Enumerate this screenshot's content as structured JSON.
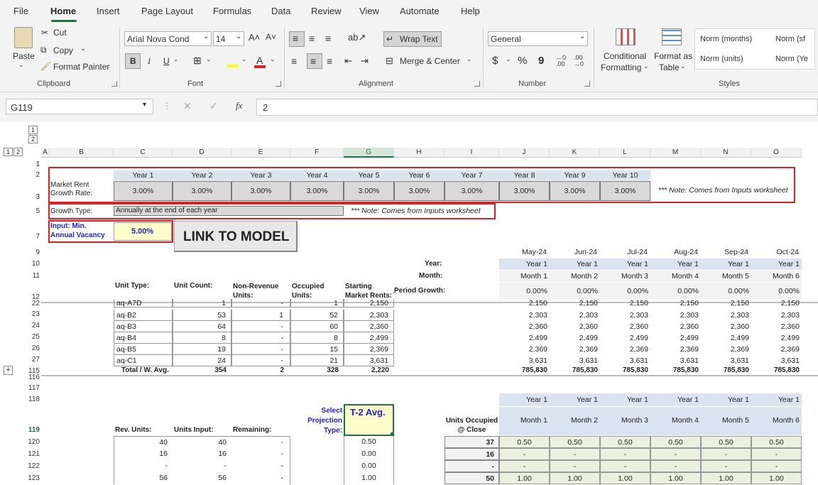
{
  "menu": {
    "items": [
      "File",
      "Home",
      "Insert",
      "Page Layout",
      "Formulas",
      "Data",
      "Review",
      "View",
      "Automate",
      "Help"
    ]
  },
  "ribbon": {
    "clipboard": {
      "paste": "Paste",
      "cut": "Cut",
      "copy": "Copy",
      "format_painter": "Format Painter",
      "label": "Clipboard"
    },
    "font": {
      "name": "Arial Nova Cond",
      "size": "14",
      "bold": "B",
      "italic": "I",
      "underline": "U",
      "label": "Font"
    },
    "alignment": {
      "wrap_text": "Wrap Text",
      "merge_center": "Merge & Center",
      "label": "Alignment"
    },
    "number": {
      "format": "General",
      "currency": "$",
      "percent": "%",
      "comma": "9",
      "label": "Number"
    },
    "styles": {
      "conditional": "Conditional",
      "formatting": "Formatting",
      "format_as": "Format as",
      "table": "Table",
      "style1": "Norm (months)",
      "style2": "Norm (sf",
      "style3": "Norm (units)",
      "style4": "Norm (Ye",
      "label": "Styles"
    }
  },
  "formula_bar": {
    "name_box": "G119",
    "fx": "fx",
    "value": "2"
  },
  "columns": [
    "A",
    "B",
    "C",
    "D",
    "E",
    "F",
    "G",
    "H",
    "I",
    "J",
    "K",
    "L",
    "M",
    "N",
    "O"
  ],
  "outline_levels": [
    "1",
    "2"
  ],
  "rows": {
    "r1": "1",
    "r2": "2",
    "r3": "3",
    "r5": "5",
    "r7": "7",
    "r9": "9",
    "r10": "10",
    "r11": "11",
    "r12": "12",
    "r22": "22",
    "r23": "23",
    "r24": "24",
    "r25": "25",
    "r26": "26",
    "r27": "27",
    "r115": "115",
    "r116": "116",
    "r117": "117",
    "r118": "118",
    "r119": "119",
    "r120": "120",
    "r121": "121",
    "r122": "122",
    "r123": "123"
  },
  "growth": {
    "label1": "Market Rent",
    "label2": "Growth Rate:",
    "years": [
      "Year 1",
      "Year 2",
      "Year 3",
      "Year 4",
      "Year 5",
      "Year 6",
      "Year 7",
      "Year 8",
      "Year 9",
      "Year 10"
    ],
    "rates": [
      "3.00%",
      "3.00%",
      "3.00%",
      "3.00%",
      "3.00%",
      "3.00%",
      "3.00%",
      "3.00%",
      "3.00%",
      "3.00%"
    ],
    "note": "*** Note: Comes from Inputs worksheet"
  },
  "growth_type": {
    "label": "Growth Type:",
    "value": "Annually at the end of each year",
    "note": "*** Note: Comes from Inputs worksheet"
  },
  "vacancy": {
    "label1": "Input: Min.",
    "label2": "Annual Vacancy",
    "value": "5.00%"
  },
  "link_button": "LINK TO MODEL",
  "timeline": {
    "months": [
      "May-24",
      "Jun-24",
      "Jul-24",
      "Aug-24",
      "Sep-24",
      "Oct-24"
    ],
    "year_label": "Year:",
    "month_label": "Month:",
    "period_label": "Period Growth:",
    "years": [
      "Year 1",
      "Year 1",
      "Year 1",
      "Year 1",
      "Year 1",
      "Year 1"
    ],
    "month_nums": [
      "Month 1",
      "Month 2",
      "Month 3",
      "Month 4",
      "Month 5",
      "Month 6"
    ],
    "growth": [
      "0.00%",
      "0.00%",
      "0.00%",
      "0.00%",
      "0.00%",
      "0.00%"
    ]
  },
  "unit_table": {
    "headers": {
      "unit_type": "Unit Type:",
      "unit_count": "Unit Count:",
      "nonrev1": "Non-Revenue",
      "nonrev2": "Units:",
      "occ1": "Occupied",
      "occ2": "Units:",
      "start1": "Starting",
      "start2": "Market Rents:"
    },
    "rows": [
      {
        "type": "aq-A7D",
        "count": "1",
        "nonrev": "-",
        "occ": "1",
        "rent": "2,150",
        "vals": [
          "2,150",
          "2,150",
          "2,150",
          "2,150",
          "2,150",
          "2,150"
        ]
      },
      {
        "type": "aq-B2",
        "count": "53",
        "nonrev": "1",
        "occ": "52",
        "rent": "2,303",
        "vals": [
          "2,303",
          "2,303",
          "2,303",
          "2,303",
          "2,303",
          "2,303"
        ]
      },
      {
        "type": "aq-B3",
        "count": "64",
        "nonrev": "-",
        "occ": "60",
        "rent": "2,360",
        "vals": [
          "2,360",
          "2,360",
          "2,360",
          "2,360",
          "2,360",
          "2,360"
        ]
      },
      {
        "type": "aq-B4",
        "count": "8",
        "nonrev": "-",
        "occ": "8",
        "rent": "2,499",
        "vals": [
          "2,499",
          "2,499",
          "2,499",
          "2,499",
          "2,499",
          "2,499"
        ]
      },
      {
        "type": "aq-B5",
        "count": "19",
        "nonrev": "-",
        "occ": "15",
        "rent": "2,369",
        "vals": [
          "2,369",
          "2,369",
          "2,369",
          "2,369",
          "2,369",
          "2,369"
        ]
      },
      {
        "type": "aq-C1",
        "count": "24",
        "nonrev": "-",
        "occ": "21",
        "rent": "3,631",
        "vals": [
          "3,631",
          "3,631",
          "3,631",
          "3,631",
          "3,631",
          "3,631"
        ]
      }
    ],
    "total": {
      "label": "Total / W. Avg.",
      "count": "354",
      "nonrev": "2",
      "occ": "328",
      "rent": "2,220",
      "vals": [
        "785,830",
        "785,830",
        "785,830",
        "785,830",
        "785,830",
        "785,830"
      ]
    }
  },
  "projection": {
    "years": [
      "Year 1",
      "Year 1",
      "Year 1",
      "Year 1",
      "Year 1",
      "Year 1"
    ],
    "months": [
      "Month 1",
      "Month 2",
      "Month 3",
      "Month 4",
      "Month 5",
      "Month 6"
    ],
    "select1": "Select",
    "select2": "Projection",
    "select3": "Type:",
    "select_value": "T-2 Avg.",
    "rev_units": "Rev. Units:",
    "units_input": "Units Input:",
    "remaining": "Remaining:",
    "occ1": "Units Occupied",
    "occ2": "@ Close",
    "rows": [
      {
        "rev": "40",
        "input": "40",
        "rem": "-",
        "g": "0.50",
        "occ": "37",
        "vals": [
          "0.50",
          "0.50",
          "0.50",
          "0.50",
          "0.50",
          "0.50"
        ]
      },
      {
        "rev": "16",
        "input": "16",
        "rem": "-",
        "g": "0.00",
        "occ": "16",
        "vals": [
          "-",
          "-",
          "-",
          "-",
          "-",
          "-"
        ]
      },
      {
        "rev": "-",
        "input": "-",
        "rem": "-",
        "g": "0.00",
        "occ": "-",
        "vals": [
          "-",
          "-",
          "-",
          "-",
          "-",
          "-"
        ]
      },
      {
        "rev": "56",
        "input": "56",
        "rem": "-",
        "g": "1.00",
        "occ": "50",
        "vals": [
          "1.00",
          "1.00",
          "1.00",
          "1.00",
          "1.00",
          "1.00"
        ]
      }
    ]
  }
}
